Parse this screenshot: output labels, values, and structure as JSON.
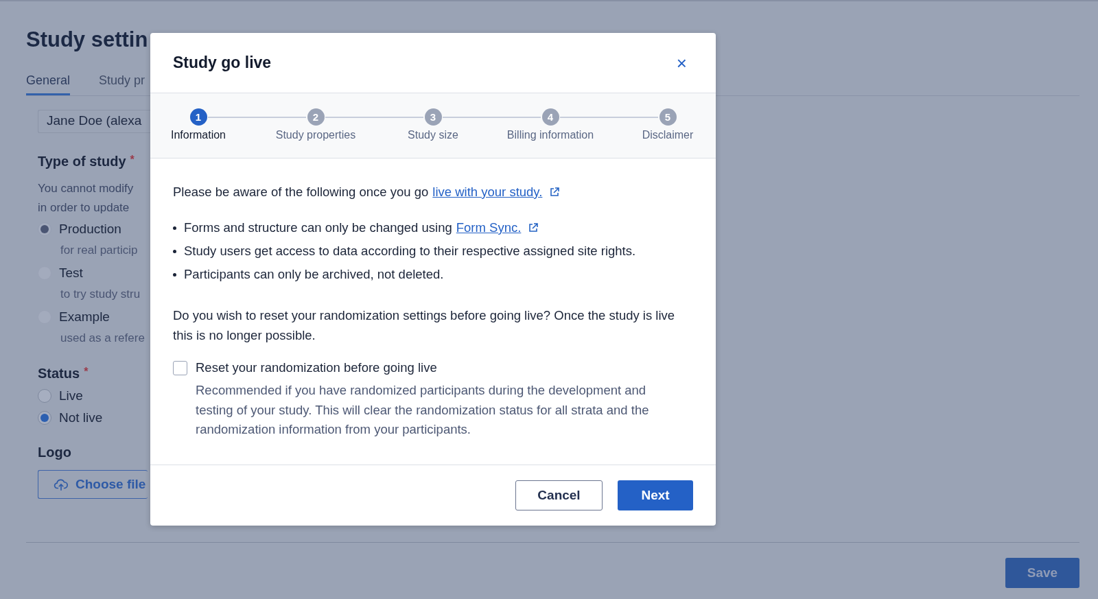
{
  "page": {
    "title": "Study settin",
    "tabs": [
      {
        "label": "General",
        "selected": true
      },
      {
        "label": "Study pr",
        "selected": false
      }
    ],
    "owner_field": {
      "value": "Jane Doe (alexa"
    },
    "type_of_study": {
      "label": "Type of study",
      "required_mark": "*",
      "description": [
        "You cannot modify",
        "in order to update"
      ],
      "options": [
        {
          "label": "Production",
          "hint": "for real particip",
          "selected": true,
          "disabled": true
        },
        {
          "label": "Test",
          "hint": "to try study stru",
          "selected": false,
          "disabled": true
        },
        {
          "label": "Example",
          "hint": "used as a refere",
          "selected": false,
          "disabled": true
        }
      ]
    },
    "status": {
      "label": "Status",
      "required_mark": "*",
      "options": [
        {
          "label": "Live",
          "selected": false,
          "disabled": false
        },
        {
          "label": "Not live",
          "selected": true,
          "disabled": false
        }
      ]
    },
    "logo": {
      "label": "Logo",
      "button": "Choose file"
    },
    "save_button": "Save"
  },
  "dialog": {
    "title": "Study go live",
    "close": "×",
    "steps": [
      {
        "number": "1",
        "label": "Information",
        "selected": true
      },
      {
        "number": "2",
        "label": "Study properties",
        "selected": false
      },
      {
        "number": "3",
        "label": "Study size",
        "selected": false
      },
      {
        "number": "4",
        "label": "Billing information",
        "selected": false
      },
      {
        "number": "5",
        "label": "Disclaimer",
        "selected": false
      }
    ],
    "intro": {
      "text": "Please be aware of the following once you go",
      "link": "live with your study."
    },
    "bullets": [
      {
        "text": "Forms and structure can only be changed using",
        "link": "Form Sync."
      },
      {
        "text": "Study users get access to data according to their respective assigned site rights."
      },
      {
        "text": "Participants can only be archived, not deleted."
      }
    ],
    "question": "Do you wish to reset your randomization settings before going live? Once the study is live this is no longer possible.",
    "reset_option": {
      "label": "Reset your randomization before going live",
      "checked": false,
      "description": "Recommended if you have randomized participants during the development and testing of your study. This will clear the randomization status for all strata and the randomization information from your participants."
    },
    "buttons": {
      "cancel": "Cancel",
      "next": "Next"
    }
  }
}
